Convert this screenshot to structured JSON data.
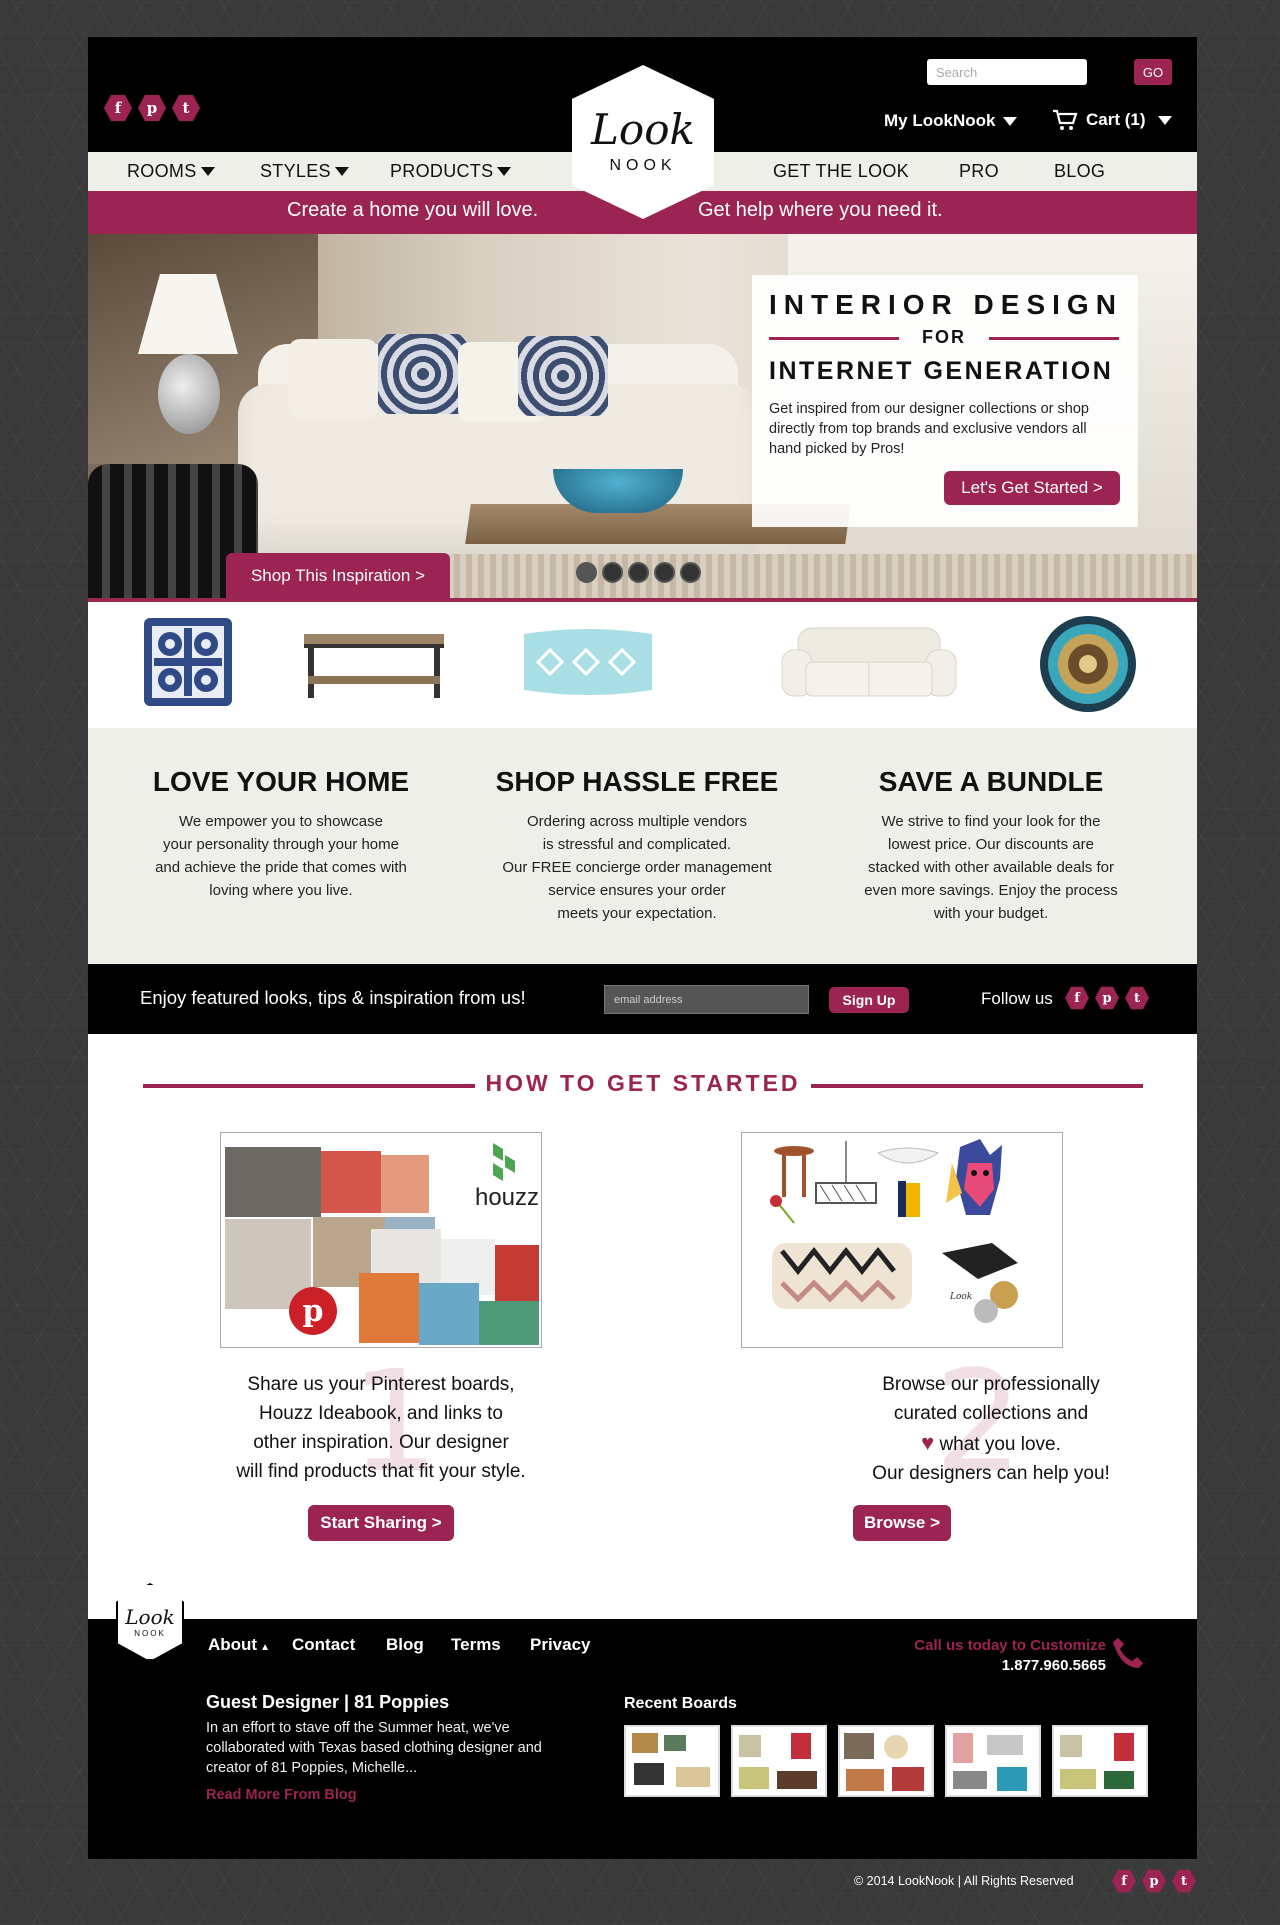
{
  "header": {
    "search_placeholder": "Search",
    "go_label": "GO",
    "my_account": "My LookNook",
    "cart_label": "Cart (1)",
    "logo_script": "Look",
    "logo_word": "NOOK",
    "social": [
      "facebook-icon",
      "pinterest-icon",
      "twitter-icon"
    ],
    "social_glyphs": [
      "f",
      "p",
      "t"
    ]
  },
  "nav": {
    "left": [
      {
        "label": "ROOMS",
        "has_dropdown": true
      },
      {
        "label": "STYLES",
        "has_dropdown": true
      },
      {
        "label": "PRODUCTS",
        "has_dropdown": true
      }
    ],
    "right": [
      {
        "label": "GET THE LOOK"
      },
      {
        "label": "PRO"
      },
      {
        "label": "BLOG"
      }
    ]
  },
  "tagline": {
    "left": "Create a home you will love.",
    "right": "Get help where you need it."
  },
  "hero": {
    "heading_top": "INTERIOR DESIGN",
    "heading_for": "FOR",
    "heading_bottom": "INTERNET GENERATION",
    "description": "Get inspired from our designer collections or shop directly from top brands and exclusive vendors all hand picked by Pros!",
    "cta": "Let's Get Started >",
    "inspiration_button": "Shop This Inspiration >",
    "slides": 5,
    "active_slide": 1
  },
  "products": [
    "blue-pillow",
    "coffee-table",
    "lumbar-pillow",
    "white-sofa",
    "decorative-plate"
  ],
  "features": [
    {
      "title": "LOVE YOUR HOME",
      "text": "We empower you to showcase\nyour personality through your home\nand achieve the pride that comes with\nloving where you live."
    },
    {
      "title": "SHOP HASSLE FREE",
      "text": "Ordering across multiple vendors\nis stressful and complicated.\nOur FREE concierge order management\nservice ensures your order\nmeets your expectation."
    },
    {
      "title": "SAVE A BUNDLE",
      "text": "We strive to find your look for the\nlowest price. Our discounts are\nstacked with other available deals for\neven more savings. Enjoy the process\nwith your budget."
    }
  ],
  "newsletter": {
    "text": "Enjoy featured looks, tips & inspiration from us!",
    "email_placeholder": "email address",
    "signup_label": "Sign Up",
    "follow_label": "Follow us"
  },
  "how": {
    "title": "HOW TO GET STARTED",
    "steps": [
      {
        "number": "1",
        "text_lines": [
          "Share us your Pinterest boards,",
          "Houzz Ideabook, and links to",
          "other inspiration. Our designer",
          "will find products that fit your style."
        ],
        "button": "Start Sharing >",
        "brand": "houzz"
      },
      {
        "number": "2",
        "text_lines": [
          "Browse our professionally",
          "curated collections and",
          "what you love.",
          "Our designers can help you!"
        ],
        "button": "Browse >"
      }
    ]
  },
  "footer": {
    "logo_script": "Look",
    "logo_word": "NOOK",
    "links": [
      "About",
      "Contact",
      "Blog",
      "Terms",
      "Privacy"
    ],
    "call_label": "Call us today to Customize",
    "phone": "1.877.960.5665",
    "blog_title": "Guest Designer | 81 Poppies",
    "blog_body": "In an effort to stave off the Summer heat, we've collaborated with Texas based clothing designer and creator of 81 Poppies, Michelle...",
    "blog_link": "Read More From Blog",
    "recent_title": "Recent Boards",
    "boards": 5
  },
  "copyright": "© 2014 LookNook | All Rights Reserved",
  "colors": {
    "accent": "#9c2452",
    "dark": "#000000",
    "light": "#efefea"
  }
}
